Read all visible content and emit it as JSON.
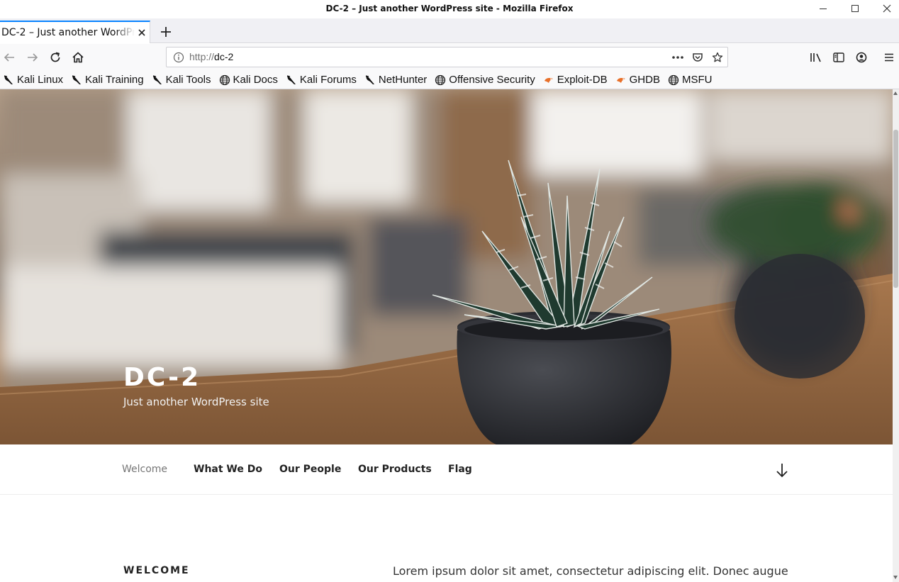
{
  "window": {
    "title": "DC-2 – Just another WordPress site - Mozilla Firefox"
  },
  "tabs": [
    {
      "label": "DC-2 – Just another WordPress site",
      "active": true
    }
  ],
  "urlbar": {
    "protocol": "http://",
    "host": "dc-2"
  },
  "bookmarks": [
    {
      "label": "Kali Linux",
      "icon": "kali-dragon-icon"
    },
    {
      "label": "Kali Training",
      "icon": "kali-dragon-icon"
    },
    {
      "label": "Kali Tools",
      "icon": "kali-dragon-icon"
    },
    {
      "label": "Kali Docs",
      "icon": "globe-icon"
    },
    {
      "label": "Kali Forums",
      "icon": "kali-dragon-icon"
    },
    {
      "label": "NetHunter",
      "icon": "kali-dragon-icon"
    },
    {
      "label": "Offensive Security",
      "icon": "globe-icon"
    },
    {
      "label": "Exploit-DB",
      "icon": "exploitdb-icon"
    },
    {
      "label": "GHDB",
      "icon": "exploitdb-icon"
    },
    {
      "label": "MSFU",
      "icon": "globe-icon"
    }
  ],
  "site": {
    "title": "DC-2",
    "description": "Just another WordPress site"
  },
  "menu": [
    {
      "label": "Welcome",
      "current": true
    },
    {
      "label": "What We Do",
      "current": false
    },
    {
      "label": "Our People",
      "current": false
    },
    {
      "label": "Our Products",
      "current": false
    },
    {
      "label": "Flag",
      "current": false
    }
  ],
  "content": {
    "section_title": "WELCOME",
    "body_text": "Lorem ipsum dolor sit amet, consectetur adipiscing elit. Donec augue"
  },
  "colors": {
    "tab_accent": "#0a84ff",
    "toolbar_bg": "#f9f9fa",
    "exploitdb_accent": "#e8702a"
  }
}
